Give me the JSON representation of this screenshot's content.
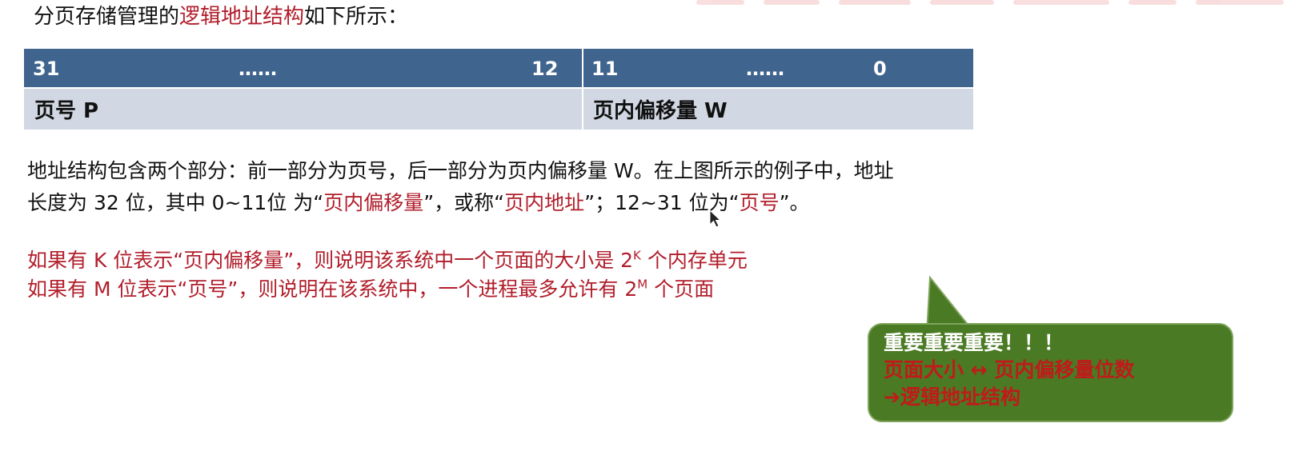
{
  "heading": {
    "prefix": "分页存储管理的",
    "highlight": "逻辑地址结构",
    "suffix": "如下所示："
  },
  "address_table": {
    "header": {
      "high_start": "31",
      "high_dots": "……",
      "high_end": "12",
      "low_start": "11",
      "low_dots": "……",
      "low_end": "0"
    },
    "body": {
      "page_number": "页号 P",
      "page_offset": "页内偏移量 W"
    }
  },
  "description": {
    "line1": "地址结构包含两个部分：前一部分为页号，后一部分为页内偏移量 W。在上图所示的例子中，地址",
    "line2_part1": "长度为 32 位，其中 0~11位 为“",
    "line2_hl1": "页内偏移量",
    "line2_part2": "”，或称“",
    "line2_hl2": "页内地址",
    "line2_part3": "”；12~31 位为“",
    "line2_hl3": "页号",
    "line2_part4": "”。"
  },
  "rules": {
    "k_rule_before": "如果有 K 位表示“页内偏移量”，则说明该系统中一个页面的大小是 2",
    "k_rule_sup": "K",
    "k_rule_after": " 个内存单元",
    "m_rule_before": "如果有 M 位表示“页号”，则说明在该系统中，一个进程最多允许有 2",
    "m_rule_sup": "M",
    "m_rule_after": " 个页面"
  },
  "callout": {
    "line1": "重要重要重要！！！",
    "line2": "页面大小 ↔ 页内偏移量位数",
    "line3": "➔逻辑地址结构"
  },
  "colors": {
    "highlight_red": "#b11e2b",
    "table_header": "#3f648e",
    "table_body": "#d2d8e3",
    "callout_bg": "#4a7a23"
  }
}
